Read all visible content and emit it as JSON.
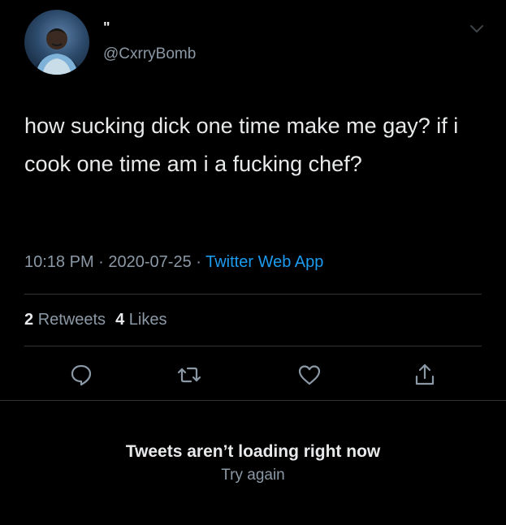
{
  "tweet": {
    "display_name": "\"",
    "handle": "@CxrryBomb",
    "text": "how sucking dick one time make me gay? if i cook one time am i a fucking chef?",
    "time": "10:18 PM",
    "separator": " · ",
    "date": "2020-07-25",
    "source": "Twitter Web App",
    "retweets_count": "2",
    "retweets_label": "Retweets",
    "likes_count": "4",
    "likes_label": "Likes"
  },
  "actions": {
    "reply_icon": "reply-icon",
    "retweet_icon": "retweet-icon",
    "like_icon": "heart-icon",
    "share_icon": "share-icon"
  },
  "status": {
    "message": "Tweets aren’t loading right now",
    "retry_label": "Try again"
  },
  "colors": {
    "background": "#000000",
    "primary_text": "#e7e9ea",
    "secondary_text": "#8b98a5",
    "accent": "#1d9bf0",
    "divider": "#2f3336"
  }
}
